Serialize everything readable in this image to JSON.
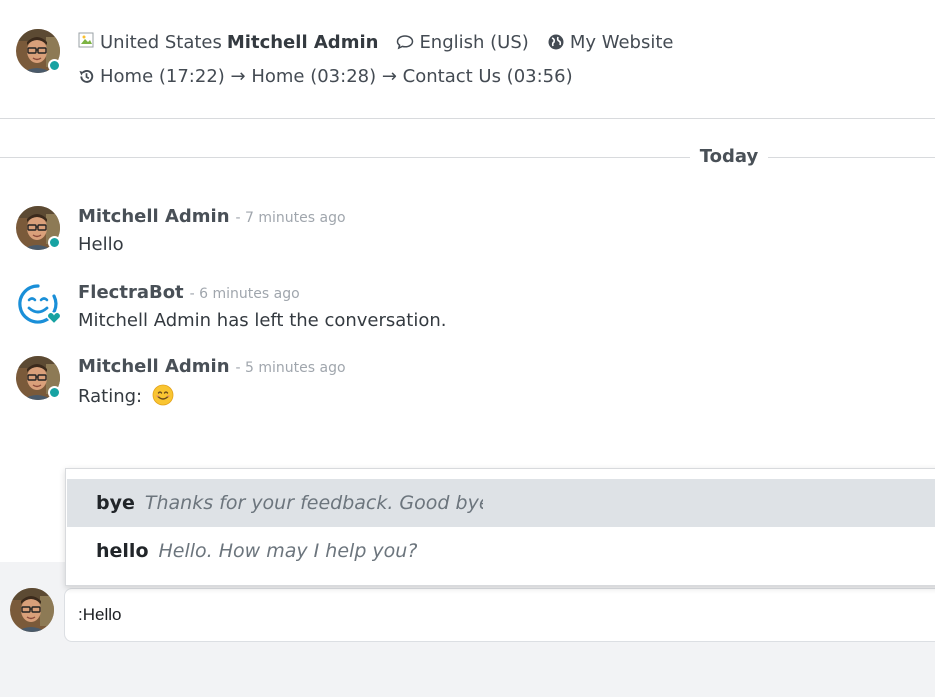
{
  "header": {
    "country": "United States",
    "partner_name": "Mitchell Admin",
    "language": "English (US)",
    "website": "My Website",
    "history": "Home (17:22) → Home (03:28) → Contact Us (03:56)"
  },
  "separator": {
    "label": "Today"
  },
  "messages": [
    {
      "author": "Mitchell Admin",
      "date": "- 7 minutes ago",
      "body": "Hello"
    },
    {
      "author": "FlectraBot",
      "date": "- 6 minutes ago",
      "body": "Mitchell Admin has left the conversation."
    },
    {
      "author": "Mitchell Admin",
      "date": "- 5 minutes ago",
      "body": "Rating:"
    }
  ],
  "suggestions": [
    {
      "key": "bye",
      "value": "Thanks for your feedback. Good bye!"
    },
    {
      "key": "hello",
      "value": "Hello. How may I help you?"
    }
  ],
  "composer": {
    "value": ":Hello"
  },
  "colors": {
    "status": "#17a2a2",
    "bot": "#1a8fd8",
    "active_row": "#dee2e6"
  },
  "icons": [
    "flag-icon",
    "comment-icon",
    "globe-icon",
    "history-icon",
    "smile-emoji-icon"
  ]
}
